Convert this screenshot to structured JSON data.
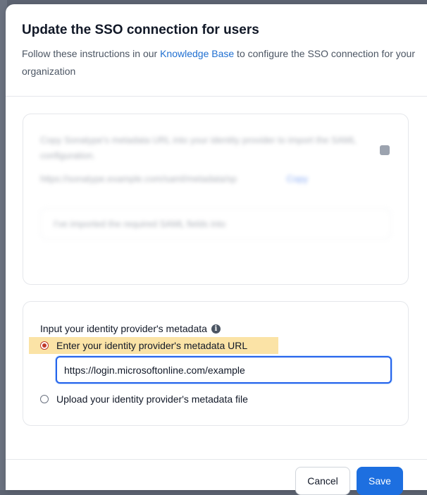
{
  "modal": {
    "title": "Update the SSO connection for users",
    "subtitle_before": "Follow these instructions in our ",
    "subtitle_link": "Knowledge Base",
    "subtitle_after": " to configure the SSO connection for your organization"
  },
  "blurred_section": {
    "line1": "Copy Sonatype's metadata URL into your identity provider to import the SAML configuration.",
    "url": "https://sonatype.example.com/saml/metadata/sp",
    "copy_label": "Copy",
    "checkbox_text": "I've imported the required SAML fields into"
  },
  "metadata": {
    "label": "Input your identity provider's metadata",
    "info_icon_glyph": "i",
    "option_url_label": "Enter your identity provider's metadata URL",
    "url_value": "https://login.microsoftonline.com/example",
    "option_file_label": "Upload your identity provider's metadata file",
    "selected_option": "url"
  },
  "footer": {
    "cancel_label": "Cancel",
    "save_label": "Save"
  },
  "colors": {
    "accent": "#1d6fe0",
    "highlight": "#fbe3a6",
    "link": "#1f6fd1"
  }
}
